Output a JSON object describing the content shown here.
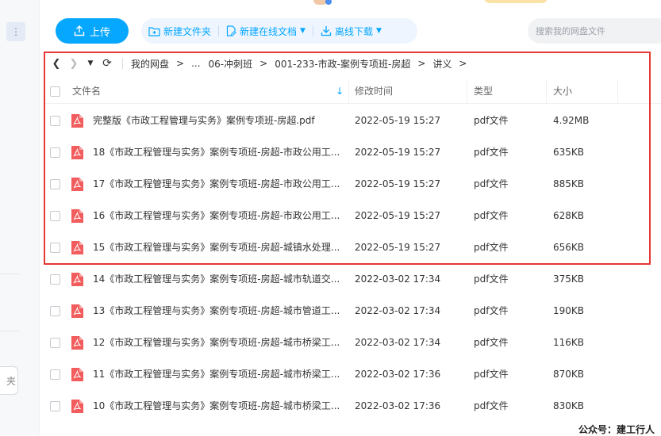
{
  "toolbar": {
    "upload_label": "上传",
    "new_folder_label": "新建文件夹",
    "new_online_doc_label": "新建在线文档",
    "offline_download_label": "离线下载"
  },
  "search": {
    "placeholder": "搜索我的网盘文件"
  },
  "sidebar": {
    "new_folder_partial": "夹"
  },
  "breadcrumb": {
    "items": [
      "我的网盘",
      "...",
      "06-冲刺班",
      "001-233-市政-案例专项班-房超",
      "讲义"
    ],
    "separator": ">"
  },
  "columns": {
    "name": "文件名",
    "modified": "修改时间",
    "type": "类型",
    "size": "大小"
  },
  "files": [
    {
      "name": "完整版《市政工程管理与实务》案例专项班-房超.pdf",
      "modified": "2022-05-19 15:27",
      "type": "pdf文件",
      "size": "4.92MB"
    },
    {
      "name": "18《市政工程管理与实务》案例专项班-房超-市政公用工...",
      "modified": "2022-05-19 15:27",
      "type": "pdf文件",
      "size": "635KB"
    },
    {
      "name": "17《市政工程管理与实务》案例专项班-房超-市政公用工...",
      "modified": "2022-05-19 15:27",
      "type": "pdf文件",
      "size": "885KB"
    },
    {
      "name": "16《市政工程管理与实务》案例专项班-房超-市政公用工...",
      "modified": "2022-05-19 15:27",
      "type": "pdf文件",
      "size": "628KB"
    },
    {
      "name": "15《市政工程管理与实务》案例专项班-房超-城镇水处理...",
      "modified": "2022-05-19 15:27",
      "type": "pdf文件",
      "size": "656KB"
    },
    {
      "name": "14《市政工程管理与实务》案例专项班-房超-城市轨道交...",
      "modified": "2022-03-02 17:34",
      "type": "pdf文件",
      "size": "375KB"
    },
    {
      "name": "13《市政工程管理与实务》案例专项班-房超-城市管道工...",
      "modified": "2022-03-02 17:34",
      "type": "pdf文件",
      "size": "190KB"
    },
    {
      "name": "12《市政工程管理与实务》案例专项班-房超-城市桥梁工...",
      "modified": "2022-03-02 17:34",
      "type": "pdf文件",
      "size": "116KB"
    },
    {
      "name": "11《市政工程管理与实务》案例专项班-房超-城市桥梁工...",
      "modified": "2022-03-02 17:36",
      "type": "pdf文件",
      "size": "870KB"
    },
    {
      "name": "10《市政工程管理与实务》案例专项班-房超-城市桥梁工...",
      "modified": "2022-03-02 17:36",
      "type": "pdf文件",
      "size": "830KB"
    }
  ],
  "watermark": "公众号：建工行人",
  "colors": {
    "accent": "#06a7ff",
    "toolbar_bg": "#eef5ff",
    "highlight": "#e53935",
    "pdf_icon": "#f25c5c"
  }
}
